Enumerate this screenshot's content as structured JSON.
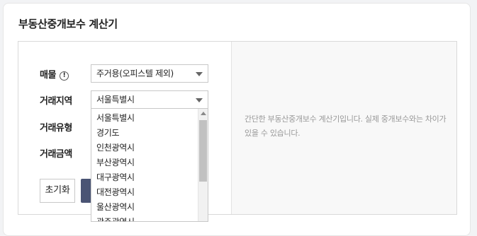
{
  "card": {
    "title": "부동산중개보수 계산기"
  },
  "form": {
    "property_label": "매물",
    "property_info_icon": "exclamation-circle-icon",
    "property_info_glyph": "!",
    "property_selected": "주거용(오피스텔 제외)",
    "region_label": "거래지역",
    "region_selected": "서울특별시",
    "type_label": "거래유형",
    "amount_label": "거래금액",
    "reset_label": "초기화"
  },
  "region_options": [
    "서울특별시",
    "경기도",
    "인천광역시",
    "부산광역시",
    "대구광역시",
    "대전광역시",
    "울산광역시",
    "광주광역시"
  ],
  "info_panel": {
    "text": "간단한 부동산중개보수 계산기입니다. 실제 중개보수와는 차이가 있을 수 있습니다."
  },
  "colors": {
    "calc_button": "#4a5474",
    "info_text": "#999999",
    "panel_bg": "#f8f8f8"
  }
}
